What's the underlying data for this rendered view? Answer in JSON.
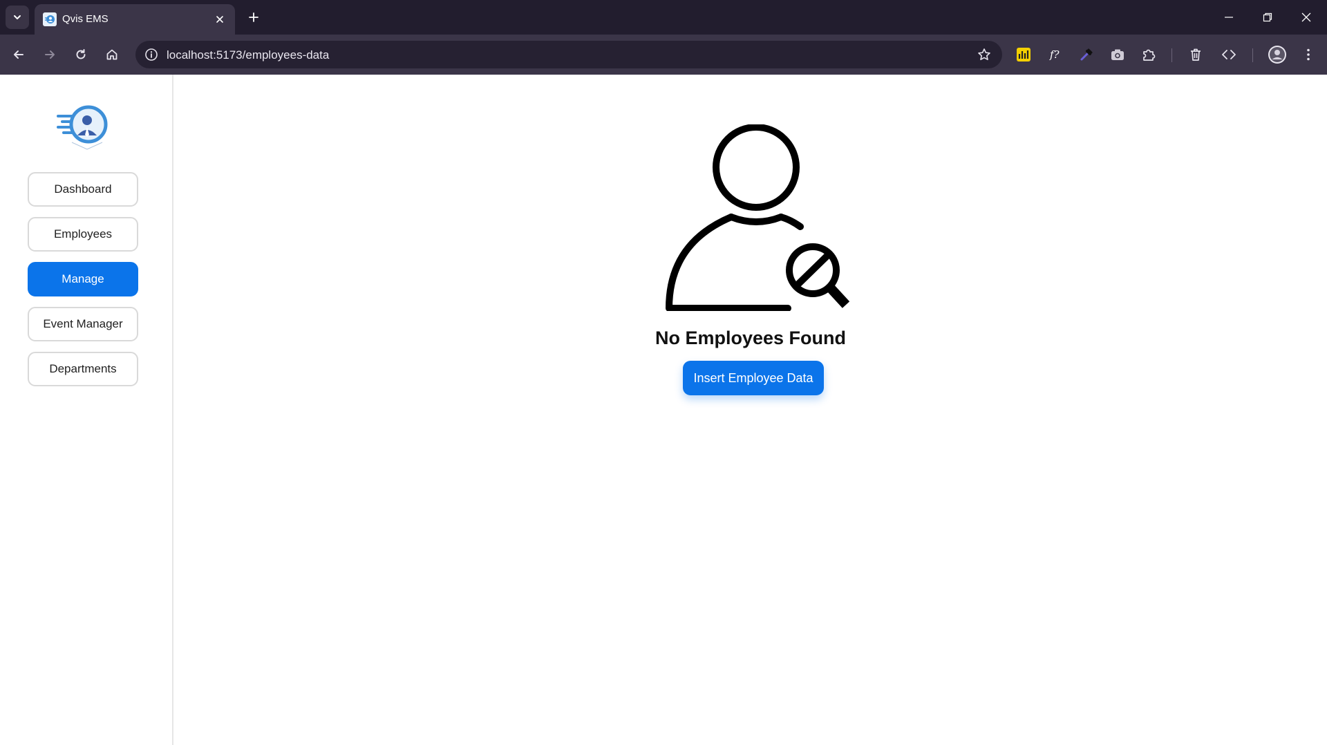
{
  "browser": {
    "tab_title": "Qvis EMS",
    "url": "localhost:5173/employees-data"
  },
  "sidebar": {
    "items": [
      {
        "label": "Dashboard",
        "active": false
      },
      {
        "label": "Employees",
        "active": false
      },
      {
        "label": "Manage",
        "active": true
      },
      {
        "label": "Event Manager",
        "active": false
      },
      {
        "label": "Departments",
        "active": false
      }
    ]
  },
  "main": {
    "empty_title": "No Employees Found",
    "insert_button": "Insert Employee Data"
  },
  "colors": {
    "accent": "#0b74ea",
    "tabbar": "#221d2e",
    "toolbar": "#3b3548"
  },
  "icons": [
    "tab-search-icon",
    "favicon-icon",
    "close-icon",
    "plus-icon",
    "back-icon",
    "forward-icon",
    "reload-icon",
    "home-icon",
    "info-icon",
    "star-icon",
    "ext-chart-icon",
    "ext-font-icon",
    "ext-eyedropper-icon",
    "ext-camera-icon",
    "extensions-icon",
    "trash-icon",
    "code-icon",
    "profile-icon",
    "menu-icon",
    "user-search-icon"
  ]
}
